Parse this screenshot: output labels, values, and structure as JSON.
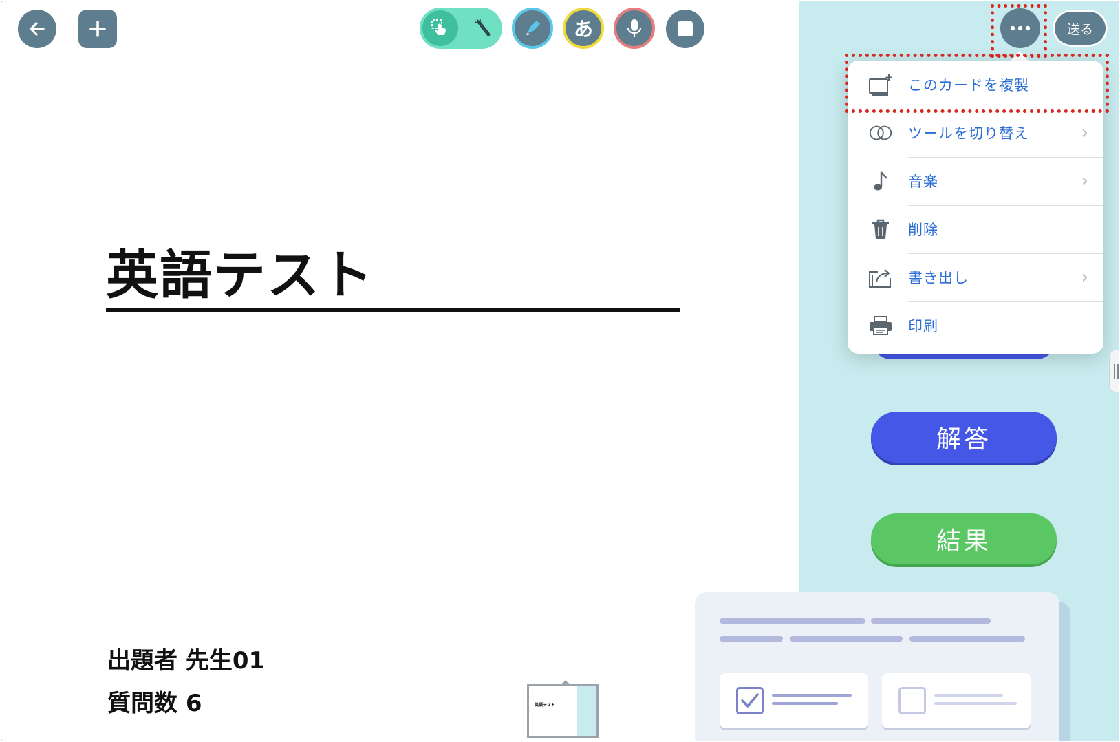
{
  "toolbar": {
    "back_icon": "arrow-left-icon",
    "add_icon": "plus-icon",
    "mode_touch_icon": "hand-pointer-icon",
    "mode_wand_icon": "magic-wand-icon",
    "pen_icon": "pen-icon",
    "text_label": "あ",
    "mic_icon": "microphone-icon",
    "shape_icon": "square-icon",
    "more_icon": "ellipsis-icon",
    "send_label": "送る",
    "colors": {
      "button": "#5e7d8f",
      "toggle": "#6fe0c4",
      "pen_ring": "#5bc7e8",
      "text_ring": "#f0db3c",
      "mic_ring": "#e57d7d"
    }
  },
  "card": {
    "title": "英語テスト",
    "author": "出題者 先生01",
    "question_count": "質問数 6"
  },
  "thumbnail": {
    "title": "英語テスト"
  },
  "side_panel": {
    "answer_label": "解答",
    "result_label": "結果",
    "colors": {
      "panel": "#c7ebee",
      "answer": "#4457e6",
      "result": "#5bc764"
    }
  },
  "menu": {
    "items": [
      {
        "label": "このカードを複製",
        "icon": "duplicate-card-icon",
        "has_submenu": false
      },
      {
        "label": "ツールを切り替え",
        "icon": "switch-tool-icon",
        "has_submenu": true
      },
      {
        "label": "音楽",
        "icon": "music-note-icon",
        "has_submenu": true
      },
      {
        "label": "削除",
        "icon": "trash-icon",
        "has_submenu": false
      },
      {
        "label": "書き出し",
        "icon": "export-icon",
        "has_submenu": true
      },
      {
        "label": "印刷",
        "icon": "printer-icon",
        "has_submenu": false
      }
    ],
    "arrow": "›",
    "label_color": "#2b6fd6"
  },
  "annotations": {
    "highlight_color": "#d62a20"
  }
}
